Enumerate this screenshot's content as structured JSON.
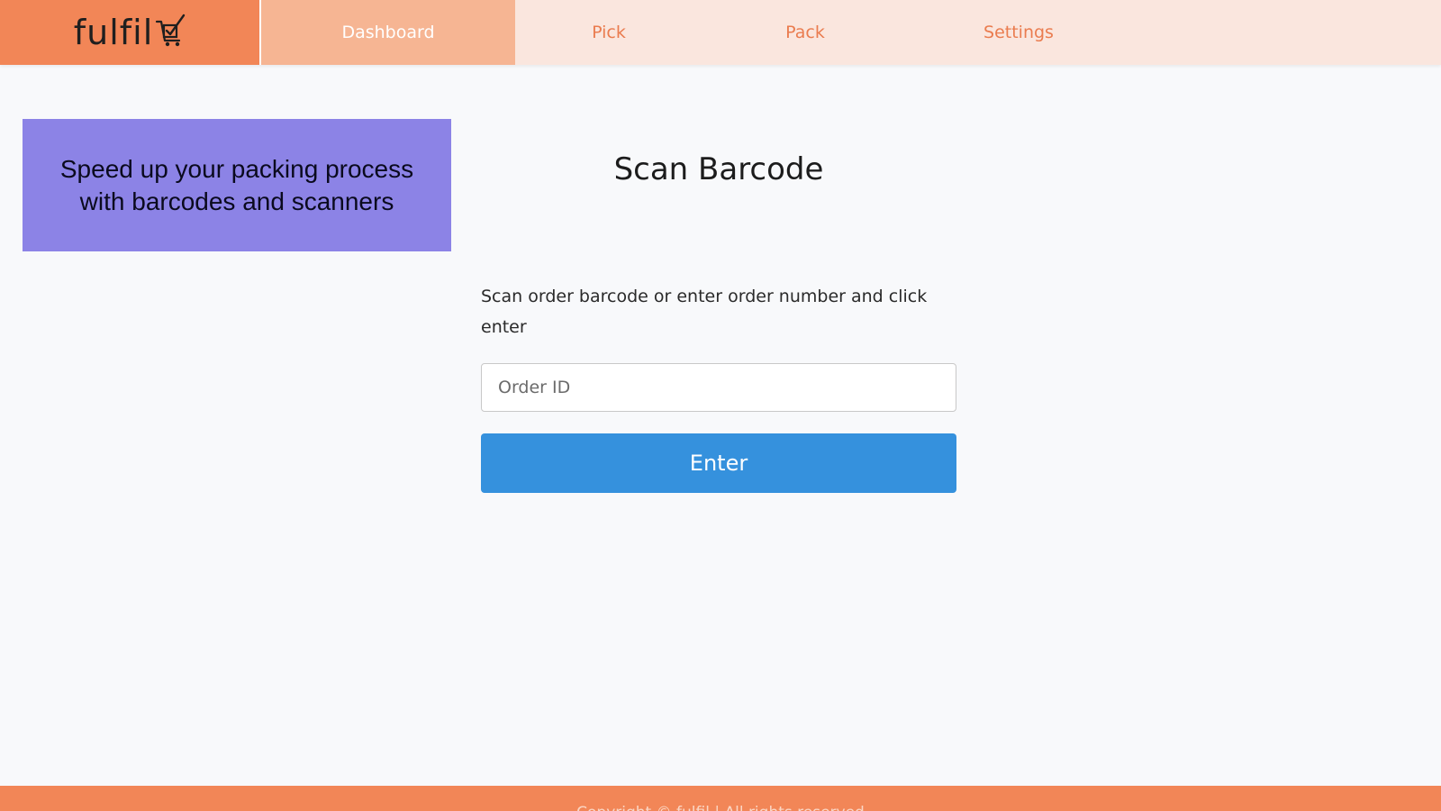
{
  "brand": {
    "logo_text": "fulfil",
    "logo_icon": "cart-checkmark-icon"
  },
  "nav": {
    "tabs": [
      {
        "label": "Dashboard",
        "active": true
      },
      {
        "label": "Pick",
        "active": false
      },
      {
        "label": "Pack",
        "active": false
      },
      {
        "label": "Settings",
        "active": false
      }
    ]
  },
  "promo": {
    "text": "Speed up your packing process with barcodes and scanners"
  },
  "main": {
    "title": "Scan Barcode",
    "instructions": "Scan order barcode or enter order number and click enter",
    "order_input": {
      "value": "",
      "placeholder": "Order ID"
    },
    "enter_label": "Enter"
  },
  "footer": {
    "text": "Copyright © fulfil | All rights reserved"
  },
  "colors": {
    "brand_orange": "#f28657",
    "nav_bg": "#fae6de",
    "active_tab": "#f6b593",
    "nav_text": "#ea7c4f",
    "promo_bg": "#8c83e6",
    "primary_button": "#3591dd",
    "page_bg": "#f8f9fb"
  }
}
